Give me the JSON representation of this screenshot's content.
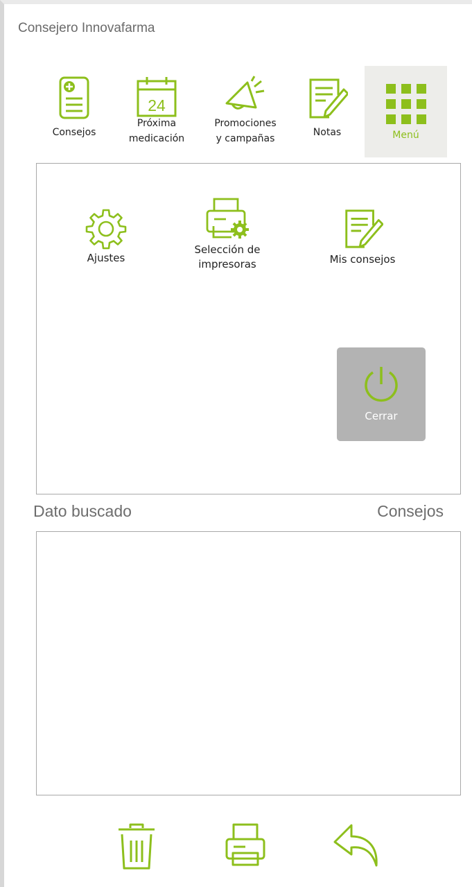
{
  "window": {
    "title": "Consejero Innovafarma"
  },
  "tabs": [
    {
      "id": "consejos",
      "label": "Consejos",
      "icon": "document-plus-icon"
    },
    {
      "id": "proxima",
      "label_line1": "Próxima",
      "label_line2": "medicación",
      "icon": "calendar-icon",
      "calendar_day": "24"
    },
    {
      "id": "promociones",
      "label_line1": "Promociones",
      "label_line2": "y campañas",
      "icon": "megaphone-icon"
    },
    {
      "id": "notas",
      "label": "Notas",
      "icon": "note-pencil-icon"
    },
    {
      "id": "menu",
      "label": "Menú",
      "icon": "grid-icon",
      "active": true
    }
  ],
  "menu_panel": {
    "items": [
      {
        "id": "ajustes",
        "label": "Ajustes",
        "icon": "gear-icon"
      },
      {
        "id": "impresoras",
        "label_line1": "Selección de",
        "label_line2": "impresoras",
        "icon": "printer-settings-icon"
      },
      {
        "id": "mis_consejos",
        "label": "Mis consejos",
        "icon": "note-pencil-icon"
      }
    ],
    "close_button": {
      "label": "Cerrar",
      "icon": "power-icon"
    }
  },
  "search": {
    "left_label": "Dato buscado",
    "right_label": "Consejos"
  },
  "bottom_actions": [
    {
      "id": "delete",
      "icon": "trash-icon"
    },
    {
      "id": "print",
      "icon": "printer-icon"
    },
    {
      "id": "back",
      "icon": "back-arrow-icon"
    }
  ],
  "colors": {
    "accent": "#8dbf1c",
    "active_tab_bg": "#ededea",
    "close_button_bg": "#b3b3b3",
    "panel_border": "#a8a8a8"
  }
}
